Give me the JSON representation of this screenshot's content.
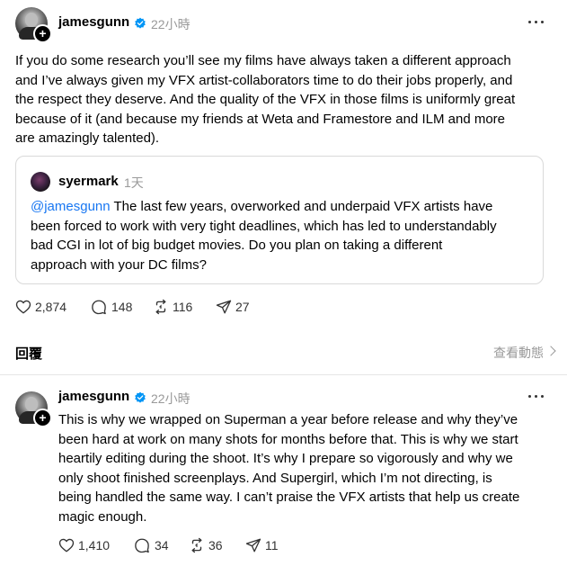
{
  "post1": {
    "username": "jamesgunn",
    "time": "22小時",
    "text": "If you do some research you’ll see my films have always taken a different approach\nand I’ve always given my VFX artist-collaborators time to do their jobs properly, and\nthe respect they deserve. And the quality of the VFX in those films is uniformly great\nbecause of it (and because my friends at Weta and Framestore and ILM and more\nare amazingly talented).",
    "quote": {
      "username": "syermark",
      "time": "1天",
      "mention": "@jamesgunn",
      "text": " The last few years, overworked and underpaid VFX artists have\nbeen forced to work with very tight deadlines, which has led to understandably\nbad CGI in lot of big budget movies. Do you plan on taking a different\napproach with your DC films?"
    },
    "likes": "2,874",
    "replies": "148",
    "reposts": "116",
    "shares": "27"
  },
  "reply_bar": {
    "label": "回覆",
    "view_activity": "查看動態"
  },
  "post2": {
    "username": "jamesgunn",
    "time": "22小時",
    "text": "This is why we wrapped on Superman a year before release and why they’ve\nbeen hard at work on many shots for months before that. This is why we start\nheartily editing during the shoot. It’s why I prepare so vigorously and why we\nonly shoot finished screenplays. And Supergirl, which I’m not directing, is\nbeing handled the same way. I can’t praise the VFX artists that help us create\nmagic enough.",
    "likes": "1,410",
    "replies": "34",
    "reposts": "36",
    "shares": "11"
  },
  "colors": {
    "verified": "#0095f6",
    "mention": "#1877f2",
    "muted": "#999999"
  },
  "icons": [
    "plus-icon",
    "verified-badge-icon",
    "more-options-icon",
    "heart-icon",
    "comment-icon",
    "repost-icon",
    "share-icon",
    "chevron-right-icon"
  ]
}
